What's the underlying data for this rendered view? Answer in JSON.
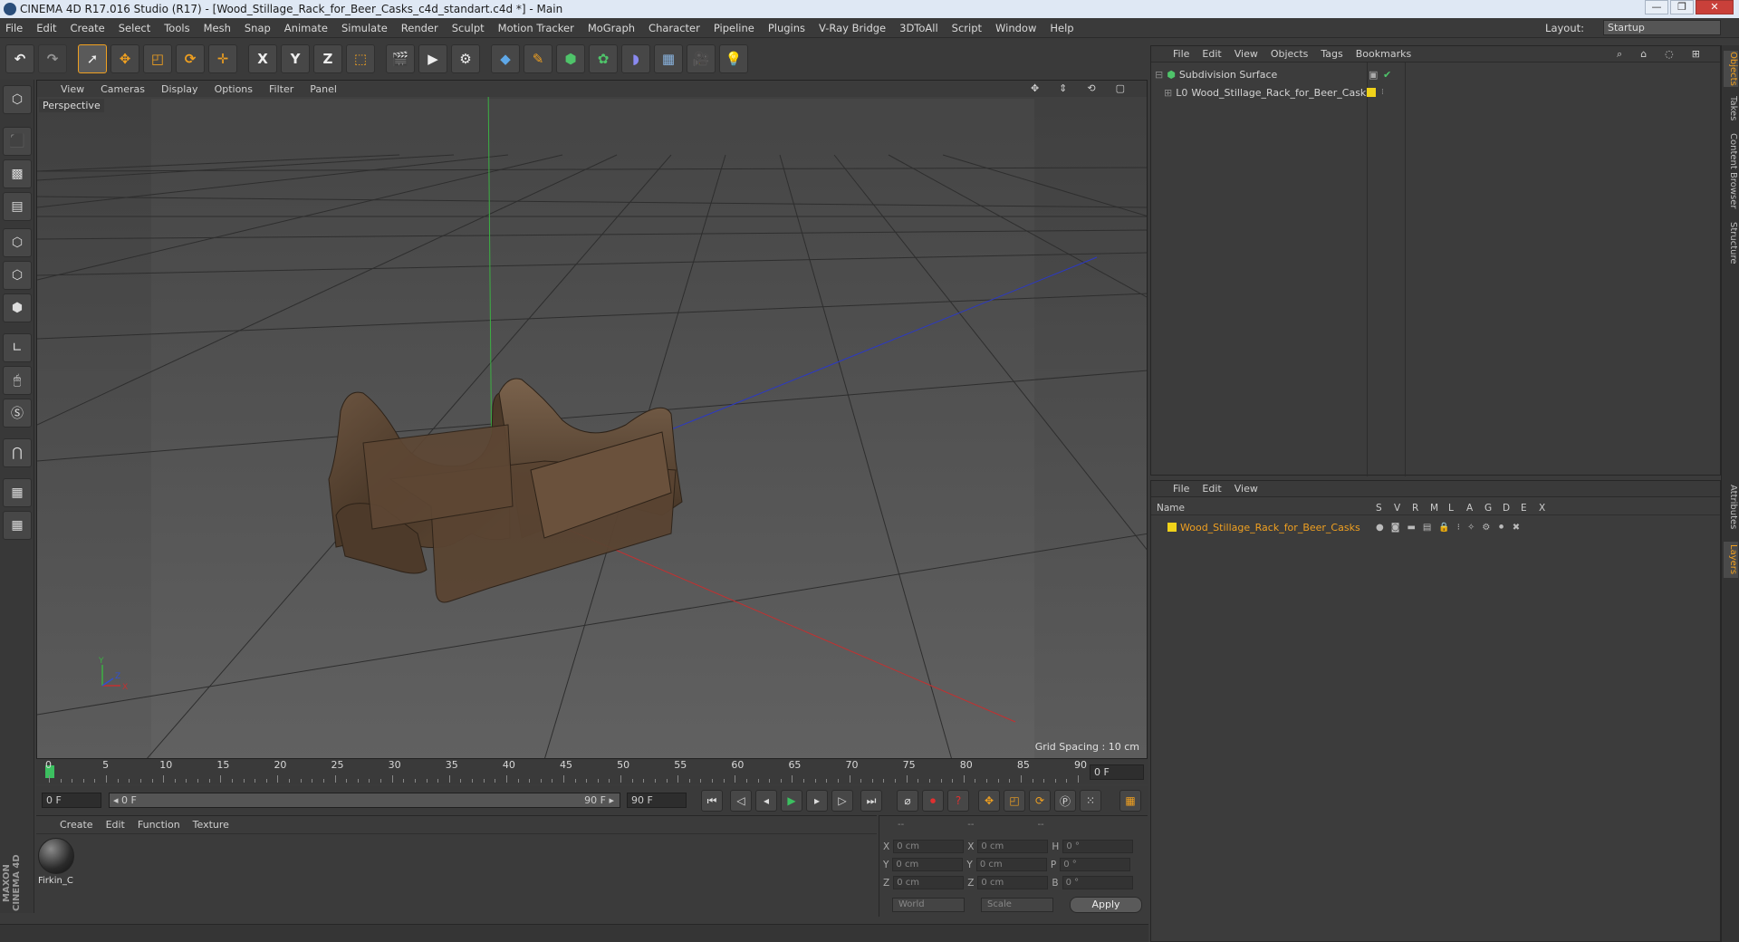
{
  "window": {
    "title": "CINEMA 4D R17.016 Studio (R17) - [Wood_Stillage_Rack_for_Beer_Casks_c4d_standart.c4d *] - Main",
    "controls": [
      "—",
      "❐",
      "✕"
    ]
  },
  "menubar": {
    "items": [
      "File",
      "Edit",
      "Create",
      "Select",
      "Tools",
      "Mesh",
      "Snap",
      "Animate",
      "Simulate",
      "Render",
      "Sculpt",
      "Motion Tracker",
      "MoGraph",
      "Character",
      "Pipeline",
      "Plugins",
      "V-Ray Bridge",
      "3DToAll",
      "Script",
      "Window",
      "Help"
    ],
    "layout_label": "Layout:",
    "layout_value": "Startup"
  },
  "toolbar": {
    "buttons": [
      "undo-icon",
      "redo-icon",
      "select-icon",
      "move-icon",
      "scale-icon",
      "rotate-icon",
      "add-icon",
      "x-axis",
      "y-axis",
      "z-axis",
      "world-coord-icon",
      "render-view-icon",
      "render-picture-icon",
      "render-settings-icon",
      "cube-icon",
      "pen-icon",
      "subdivision-icon",
      "array-icon",
      "deformer-icon",
      "floor-icon",
      "camera-icon",
      "light-icon"
    ],
    "axis_labels": [
      "X",
      "Y",
      "Z"
    ]
  },
  "viewport": {
    "menu": [
      "View",
      "Cameras",
      "Display",
      "Options",
      "Filter",
      "Panel"
    ],
    "label": "Perspective",
    "grid_spacing": "Grid Spacing : 10 cm",
    "axis_gizmo": [
      "Y",
      "X",
      "Z"
    ]
  },
  "timeline": {
    "ticks": [
      "0",
      "5",
      "10",
      "15",
      "20",
      "25",
      "30",
      "35",
      "40",
      "45",
      "50",
      "55",
      "60",
      "65",
      "70",
      "75",
      "80",
      "85",
      "90"
    ],
    "current_frame": "0 F"
  },
  "transport": {
    "start": "0 F",
    "range_start": "◂ 0 F",
    "range_end": "90 F ▸",
    "end": "90 F"
  },
  "material": {
    "menu": [
      "Create",
      "Edit",
      "Function",
      "Texture"
    ],
    "items": [
      {
        "name": "Firkin_C"
      }
    ]
  },
  "coordinates": {
    "header": [
      "--",
      "--",
      "--"
    ],
    "rows": [
      {
        "a": "X",
        "av": "0 cm",
        "b": "X",
        "bv": "0 cm",
        "c": "H",
        "cv": "0 °"
      },
      {
        "a": "Y",
        "av": "0 cm",
        "b": "Y",
        "bv": "0 cm",
        "c": "P",
        "cv": "0 °"
      },
      {
        "a": "Z",
        "av": "0 cm",
        "b": "Z",
        "bv": "0 cm",
        "c": "B",
        "cv": "0 °"
      }
    ],
    "world": "World",
    "scale": "Scale",
    "apply": "Apply"
  },
  "objects": {
    "menu": [
      "File",
      "Edit",
      "View",
      "Objects",
      "Tags",
      "Bookmarks"
    ],
    "items": [
      {
        "name": "Subdivision Surface"
      },
      {
        "name": "Wood_Stillage_Rack_for_Beer_Casks"
      }
    ]
  },
  "layers": {
    "menu": [
      "File",
      "Edit",
      "View"
    ],
    "columns": [
      "Name",
      "S",
      "V",
      "R",
      "M",
      "L",
      "A",
      "G",
      "D",
      "E",
      "X"
    ],
    "items": [
      {
        "name": "Wood_Stillage_Rack_for_Beer_Casks",
        "color": "#f0d21a"
      }
    ]
  },
  "right_tabs": [
    "Objects",
    "Takes",
    "Content Browser",
    "Structure",
    "Attributes",
    "Layers"
  ],
  "branding": "MAXON CINEMA 4D",
  "colors": {
    "accent": "#f0a020",
    "layer_yellow": "#f0d21a",
    "layer_text": "#f0a020"
  }
}
